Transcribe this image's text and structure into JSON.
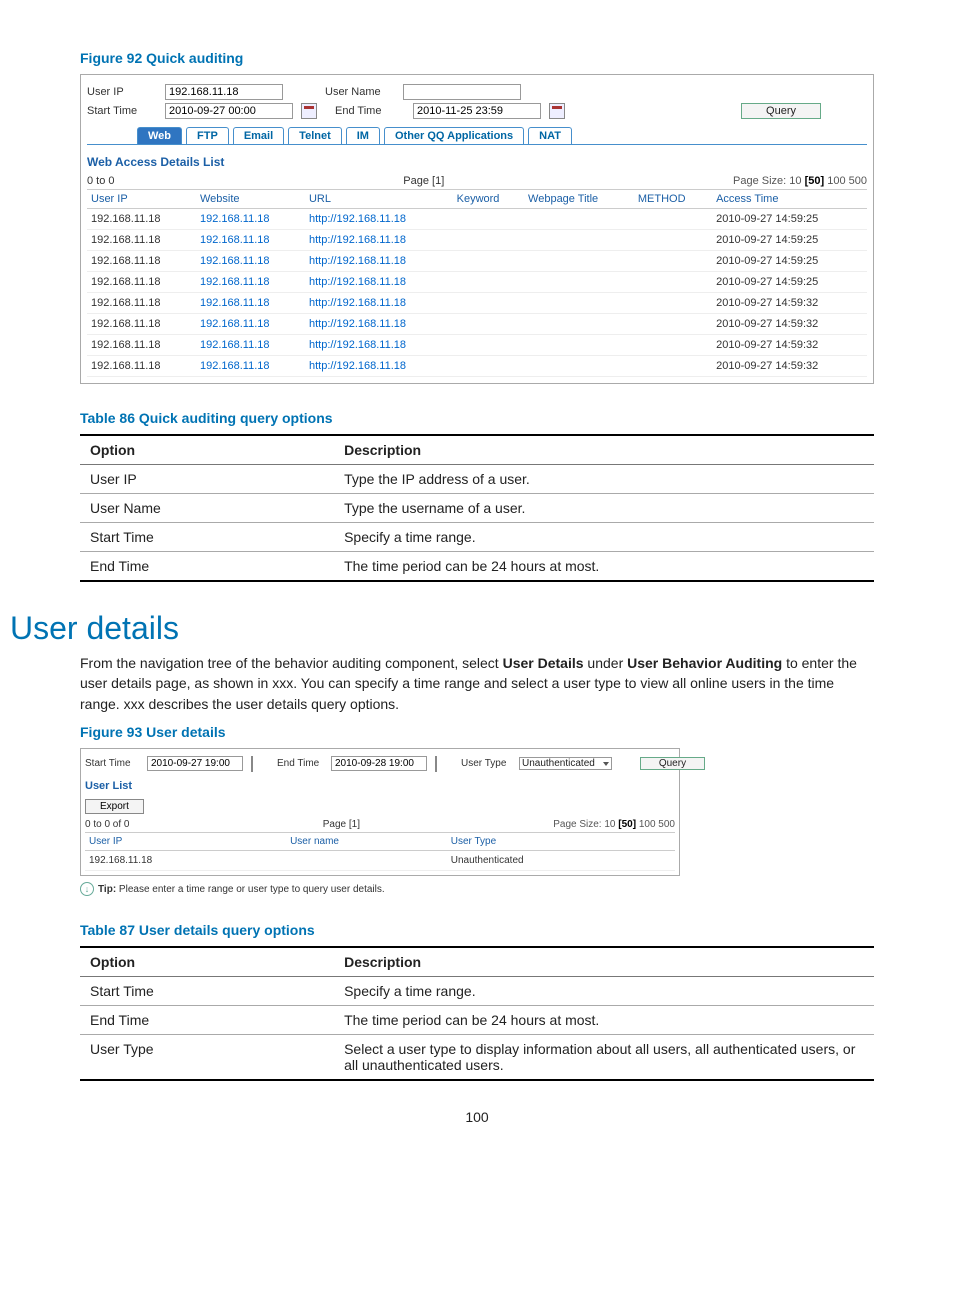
{
  "figure92": {
    "caption": "Figure 92 Quick auditing",
    "labels": {
      "user_ip": "User IP",
      "user_name": "User Name",
      "start_time": "Start Time",
      "end_time": "End Time"
    },
    "inputs": {
      "user_ip": "192.168.11.18",
      "user_name": "",
      "start_time": "2010-09-27 00:00",
      "end_time": "2010-11-25 23:59"
    },
    "query_btn": "Query",
    "tabs": [
      "Web",
      "FTP",
      "Email",
      "Telnet",
      "IM",
      "Other QQ Applications",
      "NAT"
    ],
    "active_tab": "Web",
    "list_title": "Web Access Details List",
    "range_text": "0 to 0",
    "page_text": "Page [1]",
    "page_size_label": "Page Size:",
    "page_sizes": [
      "10",
      "[50]",
      "100",
      "500"
    ],
    "columns": [
      "User IP",
      "Website",
      "URL",
      "Keyword",
      "Webpage Title",
      "METHOD",
      "Access Time"
    ],
    "rows": [
      {
        "user_ip": "192.168.11.18",
        "website": "192.168.11.18",
        "url": "http://192.168.11.18",
        "keyword": "",
        "title": "",
        "method": "",
        "time": "2010-09-27 14:59:25"
      },
      {
        "user_ip": "192.168.11.18",
        "website": "192.168.11.18",
        "url": "http://192.168.11.18",
        "keyword": "",
        "title": "",
        "method": "",
        "time": "2010-09-27 14:59:25"
      },
      {
        "user_ip": "192.168.11.18",
        "website": "192.168.11.18",
        "url": "http://192.168.11.18",
        "keyword": "",
        "title": "",
        "method": "",
        "time": "2010-09-27 14:59:25"
      },
      {
        "user_ip": "192.168.11.18",
        "website": "192.168.11.18",
        "url": "http://192.168.11.18",
        "keyword": "",
        "title": "",
        "method": "",
        "time": "2010-09-27 14:59:25"
      },
      {
        "user_ip": "192.168.11.18",
        "website": "192.168.11.18",
        "url": "http://192.168.11.18",
        "keyword": "",
        "title": "",
        "method": "",
        "time": "2010-09-27 14:59:32"
      },
      {
        "user_ip": "192.168.11.18",
        "website": "192.168.11.18",
        "url": "http://192.168.11.18",
        "keyword": "",
        "title": "",
        "method": "",
        "time": "2010-09-27 14:59:32"
      },
      {
        "user_ip": "192.168.11.18",
        "website": "192.168.11.18",
        "url": "http://192.168.11.18",
        "keyword": "",
        "title": "",
        "method": "",
        "time": "2010-09-27 14:59:32"
      },
      {
        "user_ip": "192.168.11.18",
        "website": "192.168.11.18",
        "url": "http://192.168.11.18",
        "keyword": "",
        "title": "",
        "method": "",
        "time": "2010-09-27 14:59:32"
      }
    ]
  },
  "table86": {
    "caption": "Table 86 Quick auditing query options",
    "headers": [
      "Option",
      "Description"
    ],
    "rows": [
      {
        "option": "User IP",
        "desc": "Type the IP address of a user."
      },
      {
        "option": "User Name",
        "desc": "Type the username of a user."
      },
      {
        "option": "Start Time",
        "desc": "Specify a time range."
      },
      {
        "option": "End Time",
        "desc": "The time period can be 24 hours at most."
      }
    ]
  },
  "section_heading": "User details",
  "section_para": {
    "pre": "From the navigation tree of the behavior auditing component, select ",
    "b1": "User Details",
    "mid": " under ",
    "b2": "User Behavior Auditing",
    "post": " to enter the user details page, as shown in xxx. You can specify a time range and select a user type to view all online users in the time range. xxx describes the user details query options."
  },
  "figure93": {
    "caption": "Figure 93 User details",
    "labels": {
      "start_time": "Start Time",
      "end_time": "End Time",
      "user_type": "User Type"
    },
    "inputs": {
      "start_time": "2010-09-27 19:00",
      "end_time": "2010-09-28 19:00",
      "user_type": "Unauthenticated"
    },
    "query_btn": "Query",
    "list_title": "User List",
    "export_btn": "Export",
    "range_text": "0 to 0 of 0",
    "page_text": "Page [1]",
    "page_size_label": "Page Size:",
    "page_sizes": [
      "10",
      "[50]",
      "100",
      "500"
    ],
    "columns": [
      "User IP",
      "User name",
      "User Type"
    ],
    "rows": [
      {
        "user_ip": "192.168.11.18",
        "user_name": "",
        "user_type": "Unauthenticated"
      }
    ],
    "tip_label": "Tip:",
    "tip_text": " Please enter a time range or user type to query user details."
  },
  "table87": {
    "caption": "Table 87 User details query options",
    "headers": [
      "Option",
      "Description"
    ],
    "rows": [
      {
        "option": "Start Time",
        "desc": "Specify a time range."
      },
      {
        "option": "End Time",
        "desc": "The time period can be 24 hours at most."
      },
      {
        "option": "User Type",
        "desc": "Select a user type to display information about all users, all authenticated users, or all unauthenticated users."
      }
    ]
  },
  "page_number": "100"
}
